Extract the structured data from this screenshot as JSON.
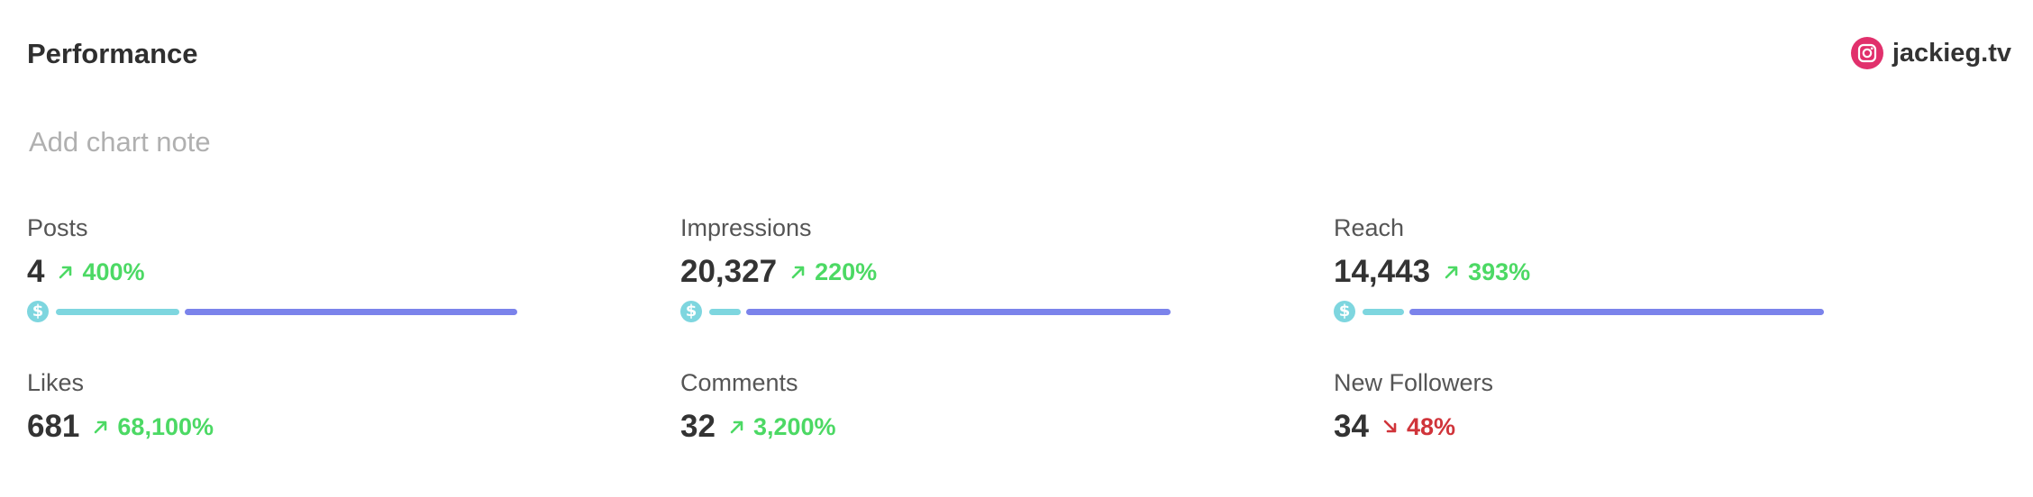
{
  "header": {
    "title": "Performance",
    "account": {
      "name": "jackieg.tv",
      "icon": "instagram-icon",
      "brand_color": "#e1306c"
    }
  },
  "chart_note": {
    "placeholder": "Add chart note"
  },
  "colors": {
    "positive": "#4cd964",
    "negative": "#d0343a",
    "paid_bar": "#7ed6df",
    "organic_bar": "#7b83eb"
  },
  "metrics": [
    {
      "label": "Posts",
      "value": "4",
      "change": "400%",
      "direction": "up",
      "breakdown": {
        "paid_fraction": 0.27,
        "organic_fraction": 0.73
      }
    },
    {
      "label": "Impressions",
      "value": "20,327",
      "change": "220%",
      "direction": "up",
      "breakdown": {
        "paid_fraction": 0.07,
        "organic_fraction": 0.93
      }
    },
    {
      "label": "Reach",
      "value": "14,443",
      "change": "393%",
      "direction": "up",
      "breakdown": {
        "paid_fraction": 0.09,
        "organic_fraction": 0.91
      }
    },
    {
      "label": "Likes",
      "value": "681",
      "change": "68,100%",
      "direction": "up"
    },
    {
      "label": "Comments",
      "value": "32",
      "change": "3,200%",
      "direction": "up"
    },
    {
      "label": "New Followers",
      "value": "34",
      "change": "48%",
      "direction": "down"
    }
  ]
}
